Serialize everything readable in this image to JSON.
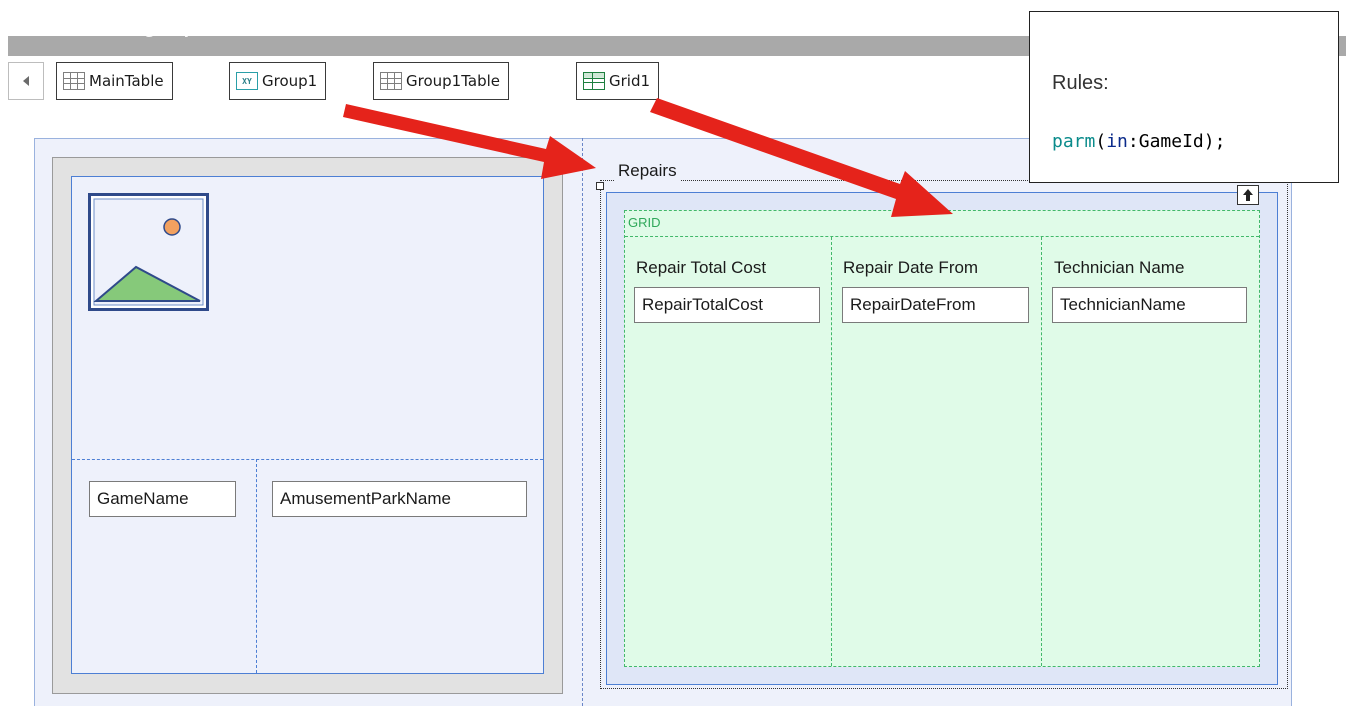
{
  "status": {
    "cut_text": "No active group selected"
  },
  "breadcrumb": {
    "back_label": "",
    "items": [
      {
        "label": "MainTable",
        "icon": "table-icon"
      },
      {
        "label": "Group1",
        "icon": "xy-group-icon",
        "icon_text": "XY"
      },
      {
        "label": "Group1Table",
        "icon": "table-icon"
      },
      {
        "label": "Grid1",
        "icon": "grid-icon"
      }
    ]
  },
  "rules": {
    "title": "Rules:",
    "code_fn": "parm",
    "code_open": "(",
    "code_kw": "in",
    "code_rest": ":GameId);"
  },
  "left_panel": {
    "image_icon": "image-placeholder-icon",
    "field_game_name": "GameName",
    "field_park_name": "AmusementParkName"
  },
  "repairs": {
    "legend": "Repairs",
    "grid_label": "GRID",
    "collapse_icon": "collapse-up-icon",
    "columns": [
      {
        "header": "Repair Total Cost",
        "field": "RepairTotalCost"
      },
      {
        "header": "Repair Date From",
        "field": "RepairDateFrom"
      },
      {
        "header": "Technician Name",
        "field": "TechnicianName"
      }
    ]
  },
  "colors": {
    "arrow": "#e5231b",
    "grid_green": "#42b86a",
    "selection_blue": "#4d7fd4"
  }
}
